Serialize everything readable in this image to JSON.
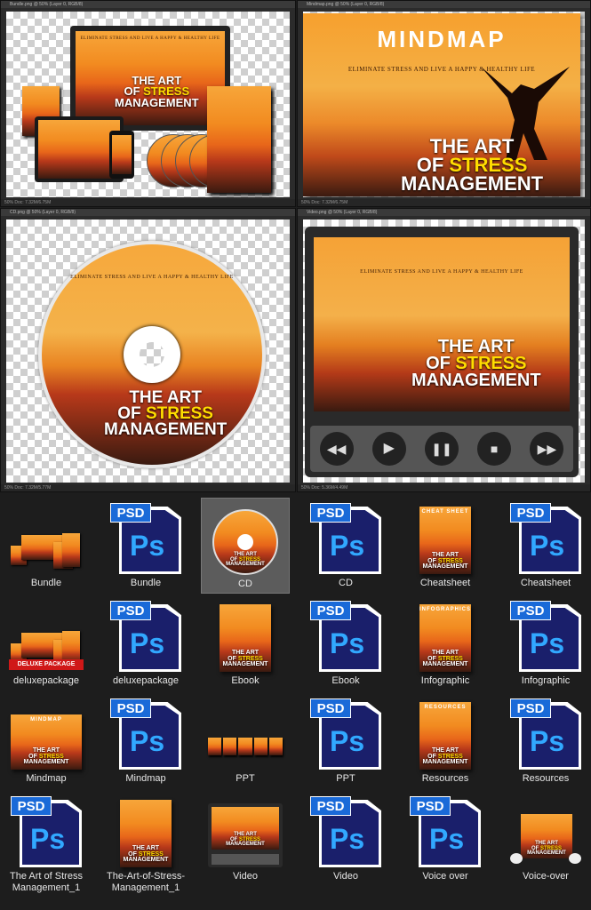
{
  "windows": {
    "bundle": {
      "title": "Bundle.png @ 50% (Layer 0, RGB/8)",
      "status": "50%     Doc: 7.32M/6.75M"
    },
    "mindmap": {
      "title": "Mindmap.png @ 50% (Layer 0, RGB/8)",
      "status": "50%     Doc: 7.32M/6.75M"
    },
    "cd": {
      "title": "CD.png @ 50% (Layer 0, RGB/8)",
      "status": "50%     Doc: 7.32M/5.77M"
    },
    "video": {
      "title": "Video.png @ 50% (Layer 0, RGB/8)",
      "status": "50%     Doc: 5.36M/4.49M"
    }
  },
  "cover": {
    "tagline": "ELIMINATE STRESS AND LIVE A HAPPY & HEALTHY LIFE",
    "title_line1": "THE ART",
    "title_of": "OF ",
    "title_stress": "STRESS",
    "title_line3": "MANAGEMENT",
    "mindmap_heading": "MINDMAP",
    "deluxe_ribbon": "DELUXE PACKAGE",
    "cheatsheet_banner": "CHEAT SHEET",
    "infographic_banner": "INFOGRAPHICS",
    "resources_banner": "RESOURCES"
  },
  "files": [
    {
      "label": "Bundle",
      "kind": "image"
    },
    {
      "label": "Bundle",
      "kind": "psd"
    },
    {
      "label": "CD",
      "kind": "image"
    },
    {
      "label": "CD",
      "kind": "psd"
    },
    {
      "label": "Cheatsheet",
      "kind": "image"
    },
    {
      "label": "Cheatsheet",
      "kind": "psd"
    },
    {
      "label": "deluxepackage",
      "kind": "image"
    },
    {
      "label": "deluxepackage",
      "kind": "psd"
    },
    {
      "label": "Ebook",
      "kind": "image"
    },
    {
      "label": "Ebook",
      "kind": "psd"
    },
    {
      "label": "Infographic",
      "kind": "image"
    },
    {
      "label": "Infographic",
      "kind": "psd"
    },
    {
      "label": "Mindmap",
      "kind": "image"
    },
    {
      "label": "Mindmap",
      "kind": "psd"
    },
    {
      "label": "PPT",
      "kind": "image"
    },
    {
      "label": "PPT",
      "kind": "psd"
    },
    {
      "label": "Resources",
      "kind": "image"
    },
    {
      "label": "Resources",
      "kind": "psd"
    },
    {
      "label": "The Art of Stress Management_1",
      "kind": "psd"
    },
    {
      "label": "The-Art-of-Stress-Management_1",
      "kind": "image"
    },
    {
      "label": "Video",
      "kind": "image"
    },
    {
      "label": "Video",
      "kind": "psd"
    },
    {
      "label": "Voice over",
      "kind": "psd"
    },
    {
      "label": "Voice-over",
      "kind": "image"
    }
  ],
  "psd_badge": "PSD",
  "ps_mark": "Ps",
  "selected_index": 2,
  "colors": {
    "accent": "#ffdd00",
    "psd_blue": "#1a6ad8",
    "ps_light": "#31a8ff",
    "ps_dark": "#1a1f6b"
  }
}
